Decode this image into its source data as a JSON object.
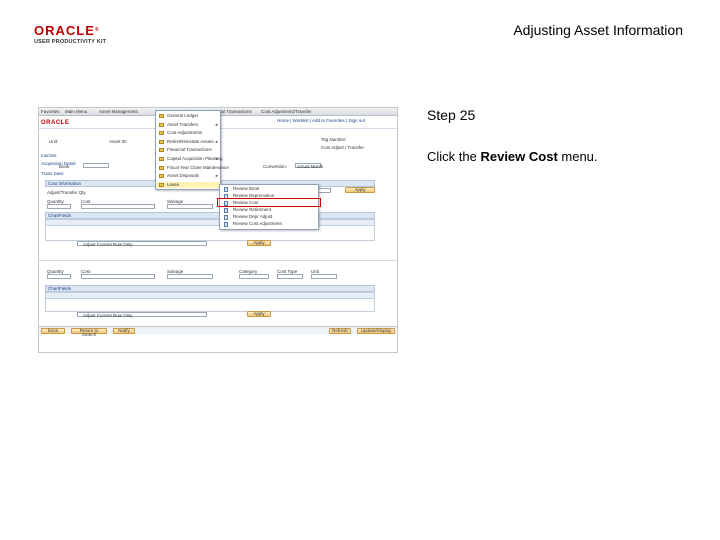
{
  "header": {
    "logo_text": "ORACLE",
    "logo_reg": "®",
    "logo_sub": "USER PRODUCTIVITY KIT",
    "title": "Adjusting Asset Information"
  },
  "step": {
    "title": "Step 25",
    "instruction_prefix": "Click the ",
    "instruction_bold": "Review Cost",
    "instruction_suffix": " menu."
  },
  "screenshot": {
    "menubar": [
      "Favorites",
      "Main Menu",
      "Asset Management",
      "Asset Transactions",
      "Financial Transactions",
      "Cost Adjustment/Transfer"
    ],
    "logo": "ORACLE",
    "toplinks": "Home  |  Worklist  |  Add to Favorites  |  Sign out",
    "top_fields": [
      "Unit:",
      "Asset ID:",
      "Profile ID:",
      "Tag Number:",
      "Cost Adjust / Transfer",
      "Inactive",
      "Acquisition Detail"
    ],
    "labels": [
      "Book:",
      "Trans Date:",
      "Accounting Date:",
      "Convention:",
      "Actual Month",
      "Cost Information",
      "Adjust/Transfer Qty",
      "Quantity",
      "Cost",
      "Salvage",
      "Category",
      "Cost Type",
      "Unit",
      "ChartFields",
      "Adjust Current Row Only",
      "Apply",
      "Done",
      "Return to Search",
      "Notify",
      "Refresh",
      "Update/Display"
    ],
    "dropdown1": [
      {
        "label": "General Ledger",
        "arrow": ""
      },
      {
        "label": "Asset Transfers",
        "arrow": "▸"
      },
      {
        "label": "Cost Adjustments",
        "arrow": ""
      },
      {
        "label": "Retire/Reinstate Assets",
        "arrow": "▸"
      },
      {
        "label": "Financial Transactions",
        "arrow": ""
      },
      {
        "label": "Capital Acquisition Planning",
        "arrow": "▸"
      },
      {
        "label": "Fiscal Year Close Maintenance",
        "arrow": ""
      },
      {
        "label": "Asset Disposals",
        "arrow": "▸"
      },
      {
        "label": "Lease",
        "arrow": ""
      }
    ],
    "dropdown2": [
      {
        "label": "Review Book"
      },
      {
        "label": "Review Depreciation"
      },
      {
        "label": "Review Cost"
      },
      {
        "label": "Review Retirement"
      },
      {
        "label": "Review Depr Adjust"
      },
      {
        "label": "Review Cost Adjustment"
      }
    ]
  }
}
